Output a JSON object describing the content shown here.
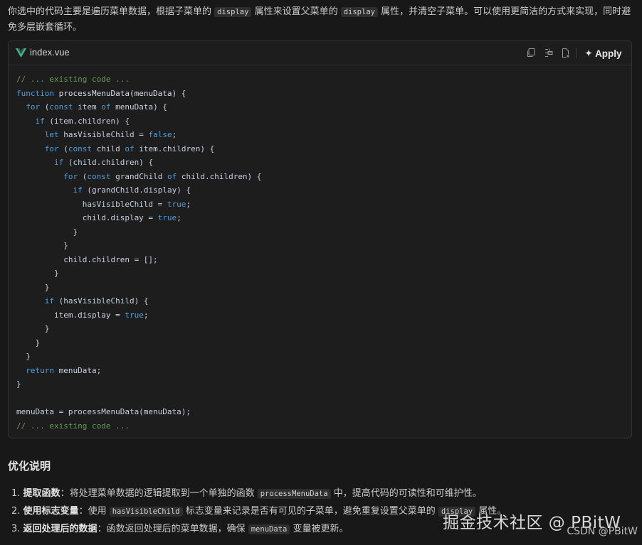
{
  "intro": {
    "t1": "你选中的代码主要是遍历菜单数据，根据子菜单的",
    "c1": "display",
    "t2": "属性来设置父菜单的",
    "c2": "display",
    "t3": "属性，并清空子菜单。可以使用更简洁的方式来实现，同时避免多层嵌套循环。"
  },
  "codeblock": {
    "filename": "index.vue",
    "apply_label": "Apply",
    "icons": [
      "copy-icon",
      "insert-icon",
      "new-file-icon"
    ],
    "lines": [
      [
        [
          "cm",
          "// ... existing code ..."
        ]
      ],
      [
        [
          "kw",
          "function "
        ],
        [
          "fn",
          "processMenuData(menuData) {"
        ]
      ],
      [
        [
          "pl",
          "  "
        ],
        [
          "kw",
          "for "
        ],
        [
          "pl",
          "("
        ],
        [
          "kw",
          "const "
        ],
        [
          "pl",
          "item "
        ],
        [
          "kw",
          "of "
        ],
        [
          "pl",
          "menuData) {"
        ]
      ],
      [
        [
          "pl",
          "    "
        ],
        [
          "kw",
          "if "
        ],
        [
          "pl",
          "(item.children) {"
        ]
      ],
      [
        [
          "pl",
          "      "
        ],
        [
          "kw",
          "let "
        ],
        [
          "pl",
          "hasVisibleChild = "
        ],
        [
          "kw",
          "false"
        ],
        [
          "pl",
          ";"
        ]
      ],
      [
        [
          "pl",
          "      "
        ],
        [
          "kw",
          "for "
        ],
        [
          "pl",
          "("
        ],
        [
          "kw",
          "const "
        ],
        [
          "pl",
          "child "
        ],
        [
          "kw",
          "of "
        ],
        [
          "pl",
          "item.children) {"
        ]
      ],
      [
        [
          "pl",
          "        "
        ],
        [
          "kw",
          "if "
        ],
        [
          "pl",
          "(child.children) {"
        ]
      ],
      [
        [
          "pl",
          "          "
        ],
        [
          "kw",
          "for "
        ],
        [
          "pl",
          "("
        ],
        [
          "kw",
          "const "
        ],
        [
          "pl",
          "grandChild "
        ],
        [
          "kw",
          "of "
        ],
        [
          "pl",
          "child.children) {"
        ]
      ],
      [
        [
          "pl",
          "            "
        ],
        [
          "kw",
          "if "
        ],
        [
          "pl",
          "(grandChild.display) {"
        ]
      ],
      [
        [
          "pl",
          "              hasVisibleChild = "
        ],
        [
          "kw",
          "true"
        ],
        [
          "pl",
          ";"
        ]
      ],
      [
        [
          "pl",
          "              child.display = "
        ],
        [
          "kw",
          "true"
        ],
        [
          "pl",
          ";"
        ]
      ],
      [
        [
          "pl",
          "            }"
        ]
      ],
      [
        [
          "pl",
          "          }"
        ]
      ],
      [
        [
          "pl",
          "          child.children = [];"
        ]
      ],
      [
        [
          "pl",
          "        }"
        ]
      ],
      [
        [
          "pl",
          "      }"
        ]
      ],
      [
        [
          "pl",
          "      "
        ],
        [
          "kw",
          "if "
        ],
        [
          "pl",
          "(hasVisibleChild) {"
        ]
      ],
      [
        [
          "pl",
          "        item.display = "
        ],
        [
          "kw",
          "true"
        ],
        [
          "pl",
          ";"
        ]
      ],
      [
        [
          "pl",
          "      }"
        ]
      ],
      [
        [
          "pl",
          "    }"
        ]
      ],
      [
        [
          "pl",
          "  }"
        ]
      ],
      [
        [
          "pl",
          "  "
        ],
        [
          "kw",
          "return "
        ],
        [
          "pl",
          "menuData;"
        ]
      ],
      [
        [
          "pl",
          "}"
        ]
      ],
      [
        [
          "pl",
          ""
        ]
      ],
      [
        [
          "pl",
          "menuData = processMenuData(menuData);"
        ]
      ],
      [
        [
          "cm",
          "// ... existing code ..."
        ]
      ]
    ]
  },
  "section": {
    "title": "优化说明",
    "points": [
      {
        "num": "1.",
        "bold": "提取函数",
        "sep": "：",
        "t1": "将处理菜单数据的逻辑提取到一个单独的函数",
        "code": "processMenuData",
        "t2": "中，提高代码的可读性和可维护性。"
      },
      {
        "num": "2.",
        "bold": "使用标志变量",
        "sep": "：",
        "t1": "使用",
        "code": "hasVisibleChild",
        "t2": "标志变量来记录是否有可见的子菜单，避免重复设置父菜单的",
        "code2": "display",
        "t3": "属性。"
      },
      {
        "num": "3.",
        "bold": "返回处理后的数据",
        "sep": "：",
        "t1": "函数返回处理后的菜单数据，确保",
        "code": "menuData",
        "t2": "变量被更新。"
      }
    ]
  },
  "watermark": "掘金技术社区 @ PBitW",
  "csdn": "CSDN @PBitW"
}
